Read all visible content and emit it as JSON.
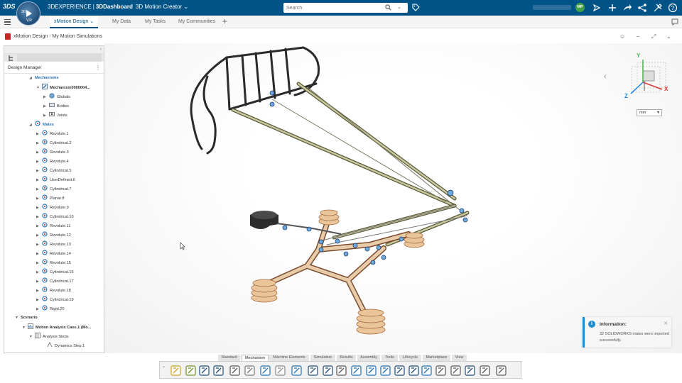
{
  "topbar": {
    "logo_text": "3DS",
    "compass_top": "3D",
    "compass_bottom": "V,R",
    "brand_prefix": "3DEXPERIENCE",
    "brand_sep": "|",
    "brand_strong": "3DDashboard",
    "app_name": "3D Motion Creator",
    "search_placeholder": "Search",
    "user_initials": "MP",
    "icons": [
      "tag-icon",
      "share-icon",
      "add-icon",
      "forward-icon",
      "network-icon",
      "tools-icon",
      "help-icon"
    ]
  },
  "tabs": {
    "active": "xMotion Design",
    "items": [
      "My Data",
      "My Tasks",
      "My Communities"
    ]
  },
  "title": {
    "text": "xMotion Design - My Motion Simulations"
  },
  "design_manager": {
    "title": "Design Manager",
    "tree": [
      {
        "label": "Mechanisms",
        "kind": "section"
      },
      {
        "label": "Mechanism0000004...",
        "kind": "bold"
      },
      {
        "label": "Globals",
        "kind": "item"
      },
      {
        "label": "Bodies",
        "kind": "item"
      },
      {
        "label": "Joints",
        "kind": "item"
      },
      {
        "label": "Mates",
        "kind": "section"
      },
      {
        "label": "Revolute.1",
        "kind": "mate"
      },
      {
        "label": "Cylindrical.2",
        "kind": "mate"
      },
      {
        "label": "Revolute.3",
        "kind": "mate"
      },
      {
        "label": "Revolute.4",
        "kind": "mate"
      },
      {
        "label": "Cylindrical.5",
        "kind": "mate"
      },
      {
        "label": "UserDefined.6",
        "kind": "mate"
      },
      {
        "label": "Cylindrical.7",
        "kind": "mate"
      },
      {
        "label": "Planar.8",
        "kind": "mate"
      },
      {
        "label": "Revolute.9",
        "kind": "mate"
      },
      {
        "label": "Cylindrical.10",
        "kind": "mate"
      },
      {
        "label": "Revolute.11",
        "kind": "mate"
      },
      {
        "label": "Revolute.12",
        "kind": "mate"
      },
      {
        "label": "Revolute.13",
        "kind": "mate"
      },
      {
        "label": "Revolute.14",
        "kind": "mate"
      },
      {
        "label": "Revolute.15",
        "kind": "mate"
      },
      {
        "label": "Cylindrical.16",
        "kind": "mate"
      },
      {
        "label": "Cylindrical.17",
        "kind": "mate"
      },
      {
        "label": "Revolute.18",
        "kind": "mate"
      },
      {
        "label": "Cylindrical.19",
        "kind": "mate"
      },
      {
        "label": "Rigid.20",
        "kind": "mate"
      },
      {
        "label": "Scenario",
        "kind": "bold"
      },
      {
        "label": "Motion Analysis Case.1 (Mo...",
        "kind": "bold"
      },
      {
        "label": "Analysis Steps",
        "kind": "item"
      },
      {
        "label": "Dynamics Step.1",
        "kind": "item"
      }
    ]
  },
  "viewport": {
    "unit": "mm",
    "axes": {
      "x": "X",
      "y": "Y",
      "z": "Z"
    }
  },
  "notification": {
    "title": "Information:",
    "body": "32 SOLIDWORKS mates were imported successfully."
  },
  "section_tabs": [
    "Standard",
    "Mechanism",
    "Machine Elements",
    "Simulation",
    "Results",
    "Assembly",
    "Tools",
    "Lifecycle",
    "Marketplace",
    "View"
  ],
  "section_tab_active": "Mechanism",
  "colors": {
    "topbar": "#005386",
    "accent": "#2a73b5",
    "info": "#1d8fd0"
  }
}
